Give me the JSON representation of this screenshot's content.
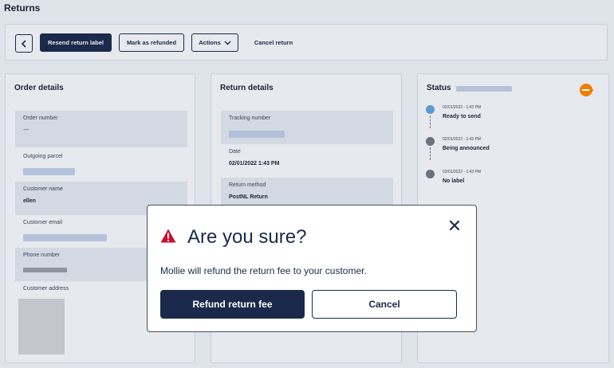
{
  "page": {
    "title": "Returns"
  },
  "toolbar": {
    "back_icon": "chevron-left-icon",
    "resend_label": "Resend return label",
    "mark_refunded_label": "Mark as refunded",
    "actions_label": "Actions",
    "actions_icon": "chevron-down-icon",
    "cancel_return_label": "Cancel return"
  },
  "order_details": {
    "title": "Order details",
    "order_number_label": "Order number",
    "order_number_value": "---",
    "outgoing_parcel_label": "Outgoing parcel",
    "customer_name_label": "Customer name",
    "customer_name_value": "ellen",
    "customer_email_label": "Customer email",
    "phone_number_label": "Phone number",
    "customer_address_label": "Customer address"
  },
  "return_details": {
    "title": "Return details",
    "tracking_number_label": "Tracking number",
    "date_label": "Date",
    "date_value": "02/01/2022 1:43 PM",
    "return_method_label": "Return method",
    "return_method_value": "PostNL Return"
  },
  "status": {
    "title": "Status",
    "carrier_icon": "postnl-logo-icon",
    "events": [
      {
        "time": "02/01/2022 - 1:43 PM",
        "label": "Ready to send",
        "color": "#5b9bd5"
      },
      {
        "time": "02/01/2022 - 1:43 PM",
        "label": "Being announced",
        "color": "#6b7280"
      },
      {
        "time": "02/01/2022 - 1:43 PM",
        "label": "No label",
        "color": "#6b7280"
      }
    ]
  },
  "modal": {
    "title": "Are you sure?",
    "message": "Mollie will refund the return fee to your customer.",
    "primary_label": "Refund return fee",
    "secondary_label": "Cancel",
    "warning_icon": "warning-icon",
    "close_icon": "close-icon",
    "warning_color": "#c8102e",
    "primary_color": "#1b2a4a"
  }
}
